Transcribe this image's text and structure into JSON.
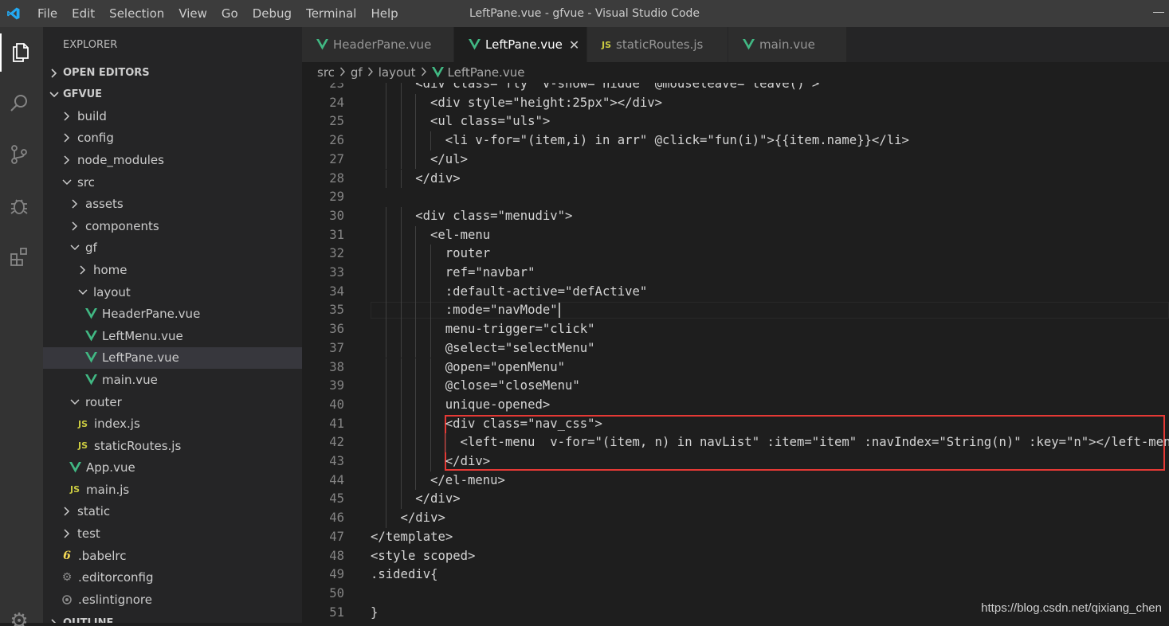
{
  "window": {
    "title": "LeftPane.vue - gfvue - Visual Studio Code",
    "menu": [
      "File",
      "Edit",
      "Selection",
      "View",
      "Go",
      "Debug",
      "Terminal",
      "Help"
    ]
  },
  "colors": {
    "vue_green": "#41b883",
    "vscode_blue": "#23a9f2",
    "js_yellow": "#cbcb41",
    "annotation_red": "#e53935"
  },
  "sidebar": {
    "explorer_title": "EXPLORER",
    "open_editors_label": "OPEN EDITORS",
    "project_label": "GFVUE",
    "outline_label": "OUTLINE",
    "tree": [
      {
        "label": "build",
        "type": "folder",
        "level": 0,
        "open": false
      },
      {
        "label": "config",
        "type": "folder",
        "level": 0,
        "open": false
      },
      {
        "label": "node_modules",
        "type": "folder",
        "level": 0,
        "open": false
      },
      {
        "label": "src",
        "type": "folder",
        "level": 0,
        "open": true
      },
      {
        "label": "assets",
        "type": "folder",
        "level": 1,
        "open": false
      },
      {
        "label": "components",
        "type": "folder",
        "level": 1,
        "open": false
      },
      {
        "label": "gf",
        "type": "folder",
        "level": 1,
        "open": true
      },
      {
        "label": "home",
        "type": "folder",
        "level": 2,
        "open": false
      },
      {
        "label": "layout",
        "type": "folder",
        "level": 2,
        "open": true
      },
      {
        "label": "HeaderPane.vue",
        "type": "vue",
        "level": 3
      },
      {
        "label": "LeftMenu.vue",
        "type": "vue",
        "level": 3
      },
      {
        "label": "LeftPane.vue",
        "type": "vue",
        "level": 3,
        "selected": true
      },
      {
        "label": "main.vue",
        "type": "vue",
        "level": 3
      },
      {
        "label": "router",
        "type": "folder",
        "level": 1,
        "open": true
      },
      {
        "label": "index.js",
        "type": "js",
        "level": 2
      },
      {
        "label": "staticRoutes.js",
        "type": "js",
        "level": 2
      },
      {
        "label": "App.vue",
        "type": "vue",
        "level": 1
      },
      {
        "label": "main.js",
        "type": "js",
        "level": 1
      },
      {
        "label": "static",
        "type": "folder",
        "level": 0,
        "open": false
      },
      {
        "label": "test",
        "type": "folder",
        "level": 0,
        "open": false
      },
      {
        "label": ".babelrc",
        "type": "babel",
        "level": 0
      },
      {
        "label": ".editorconfig",
        "type": "gear",
        "level": 0
      },
      {
        "label": ".eslintignore",
        "type": "eslint",
        "level": 0
      }
    ]
  },
  "tabs": [
    {
      "label": "HeaderPane.vue",
      "icon": "vue-icon",
      "active": false
    },
    {
      "label": "LeftPane.vue",
      "icon": "vue-icon",
      "active": true
    },
    {
      "label": "staticRoutes.js",
      "icon": "js-icon",
      "active": false
    },
    {
      "label": "main.vue",
      "icon": "vue-icon",
      "active": false
    }
  ],
  "breadcrumb": [
    "src",
    "gf",
    "layout",
    "LeftPane.vue"
  ],
  "editor": {
    "cursor_line": 35,
    "lines": [
      {
        "n": "23",
        "indent": 3,
        "text": "<div class=\"fly\" v-show=\"hidde\" @mouseleave=\"leave()\">"
      },
      {
        "n": "24",
        "indent": 4,
        "text": "<div style=\"height:25px\"></div>"
      },
      {
        "n": "25",
        "indent": 4,
        "text": "<ul class=\"uls\">"
      },
      {
        "n": "26",
        "indent": 5,
        "text": "<li v-for=\"(item,i) in arr\" @click=\"fun(i)\">{{item.name}}</li>"
      },
      {
        "n": "27",
        "indent": 4,
        "text": "</ul>"
      },
      {
        "n": "28",
        "indent": 3,
        "text": "</div>"
      },
      {
        "n": "29",
        "indent": 0,
        "text": ""
      },
      {
        "n": "30",
        "indent": 3,
        "text": "<div class=\"menudiv\">"
      },
      {
        "n": "31",
        "indent": 4,
        "text": "<el-menu"
      },
      {
        "n": "32",
        "indent": 5,
        "text": "router"
      },
      {
        "n": "33",
        "indent": 5,
        "text": "ref=\"navbar\""
      },
      {
        "n": "34",
        "indent": 5,
        "text": ":default-active=\"defActive\""
      },
      {
        "n": "35",
        "indent": 5,
        "text": ":mode=\"navMode\""
      },
      {
        "n": "36",
        "indent": 5,
        "text": "menu-trigger=\"click\""
      },
      {
        "n": "37",
        "indent": 5,
        "text": "@select=\"selectMenu\""
      },
      {
        "n": "38",
        "indent": 5,
        "text": "@open=\"openMenu\""
      },
      {
        "n": "39",
        "indent": 5,
        "text": "@close=\"closeMenu\""
      },
      {
        "n": "40",
        "indent": 5,
        "text": "unique-opened>"
      },
      {
        "n": "41",
        "indent": 5,
        "text": "<div class=\"nav_css\">"
      },
      {
        "n": "42",
        "indent": 6,
        "text": "<left-menu  v-for=\"(item, n) in navList\" :item=\"item\" :navIndex=\"String(n)\" :key=\"n\"></left-menu>"
      },
      {
        "n": "43",
        "indent": 5,
        "text": "</div>"
      },
      {
        "n": "44",
        "indent": 4,
        "text": "</el-menu>"
      },
      {
        "n": "45",
        "indent": 3,
        "text": "</div>"
      },
      {
        "n": "46",
        "indent": 2,
        "text": "</div>"
      },
      {
        "n": "47",
        "indent": 0,
        "text": "</template>"
      },
      {
        "n": "48",
        "indent": 0,
        "text": "<style scoped>"
      },
      {
        "n": "49",
        "indent": 0,
        "text": ".sidediv{"
      },
      {
        "n": "50",
        "indent": 0,
        "text": ""
      },
      {
        "n": "51",
        "indent": 0,
        "text": "}"
      }
    ]
  },
  "watermark": "https://blog.csdn.net/qixiang_chen"
}
